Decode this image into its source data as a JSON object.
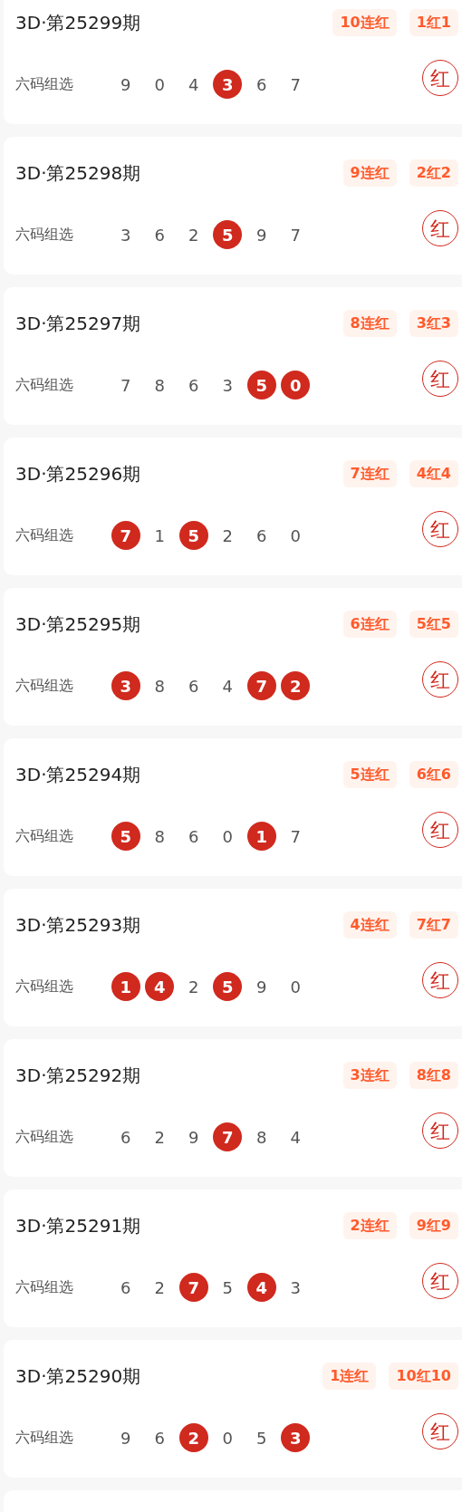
{
  "draws": [
    {
      "title": "3D·第25299期",
      "streak": "10连红",
      "record": "1红1",
      "label": "六码组选",
      "numbers": [
        {
          "value": "9",
          "hit": false
        },
        {
          "value": "0",
          "hit": false
        },
        {
          "value": "4",
          "hit": false
        },
        {
          "value": "3",
          "hit": true
        },
        {
          "value": "6",
          "hit": false
        },
        {
          "value": "7",
          "hit": false
        }
      ],
      "result": "红"
    },
    {
      "title": "3D·第25298期",
      "streak": "9连红",
      "record": "2红2",
      "label": "六码组选",
      "numbers": [
        {
          "value": "3",
          "hit": false
        },
        {
          "value": "6",
          "hit": false
        },
        {
          "value": "2",
          "hit": false
        },
        {
          "value": "5",
          "hit": true
        },
        {
          "value": "9",
          "hit": false
        },
        {
          "value": "7",
          "hit": false
        }
      ],
      "result": "红"
    },
    {
      "title": "3D·第25297期",
      "streak": "8连红",
      "record": "3红3",
      "label": "六码组选",
      "numbers": [
        {
          "value": "7",
          "hit": false
        },
        {
          "value": "8",
          "hit": false
        },
        {
          "value": "6",
          "hit": false
        },
        {
          "value": "3",
          "hit": false
        },
        {
          "value": "5",
          "hit": true
        },
        {
          "value": "0",
          "hit": true
        }
      ],
      "result": "红"
    },
    {
      "title": "3D·第25296期",
      "streak": "7连红",
      "record": "4红4",
      "label": "六码组选",
      "numbers": [
        {
          "value": "7",
          "hit": true
        },
        {
          "value": "1",
          "hit": false
        },
        {
          "value": "5",
          "hit": true
        },
        {
          "value": "2",
          "hit": false
        },
        {
          "value": "6",
          "hit": false
        },
        {
          "value": "0",
          "hit": false
        }
      ],
      "result": "红"
    },
    {
      "title": "3D·第25295期",
      "streak": "6连红",
      "record": "5红5",
      "label": "六码组选",
      "numbers": [
        {
          "value": "3",
          "hit": true
        },
        {
          "value": "8",
          "hit": false
        },
        {
          "value": "6",
          "hit": false
        },
        {
          "value": "4",
          "hit": false
        },
        {
          "value": "7",
          "hit": true
        },
        {
          "value": "2",
          "hit": true
        }
      ],
      "result": "红"
    },
    {
      "title": "3D·第25294期",
      "streak": "5连红",
      "record": "6红6",
      "label": "六码组选",
      "numbers": [
        {
          "value": "5",
          "hit": true
        },
        {
          "value": "8",
          "hit": false
        },
        {
          "value": "6",
          "hit": false
        },
        {
          "value": "0",
          "hit": false
        },
        {
          "value": "1",
          "hit": true
        },
        {
          "value": "7",
          "hit": false
        }
      ],
      "result": "红"
    },
    {
      "title": "3D·第25293期",
      "streak": "4连红",
      "record": "7红7",
      "label": "六码组选",
      "numbers": [
        {
          "value": "1",
          "hit": true
        },
        {
          "value": "4",
          "hit": true
        },
        {
          "value": "2",
          "hit": false
        },
        {
          "value": "5",
          "hit": true
        },
        {
          "value": "9",
          "hit": false
        },
        {
          "value": "0",
          "hit": false
        }
      ],
      "result": "红"
    },
    {
      "title": "3D·第25292期",
      "streak": "3连红",
      "record": "8红8",
      "label": "六码组选",
      "numbers": [
        {
          "value": "6",
          "hit": false
        },
        {
          "value": "2",
          "hit": false
        },
        {
          "value": "9",
          "hit": false
        },
        {
          "value": "7",
          "hit": true
        },
        {
          "value": "8",
          "hit": false
        },
        {
          "value": "4",
          "hit": false
        }
      ],
      "result": "红"
    },
    {
      "title": "3D·第25291期",
      "streak": "2连红",
      "record": "9红9",
      "label": "六码组选",
      "numbers": [
        {
          "value": "6",
          "hit": false
        },
        {
          "value": "2",
          "hit": false
        },
        {
          "value": "7",
          "hit": true
        },
        {
          "value": "5",
          "hit": false
        },
        {
          "value": "4",
          "hit": true
        },
        {
          "value": "3",
          "hit": false
        }
      ],
      "result": "红"
    },
    {
      "title": "3D·第25290期",
      "streak": "1连红",
      "record": "10红10",
      "label": "六码组选",
      "numbers": [
        {
          "value": "9",
          "hit": false
        },
        {
          "value": "6",
          "hit": false
        },
        {
          "value": "2",
          "hit": true
        },
        {
          "value": "0",
          "hit": false
        },
        {
          "value": "5",
          "hit": false
        },
        {
          "value": "3",
          "hit": true
        }
      ],
      "result": "红"
    }
  ]
}
